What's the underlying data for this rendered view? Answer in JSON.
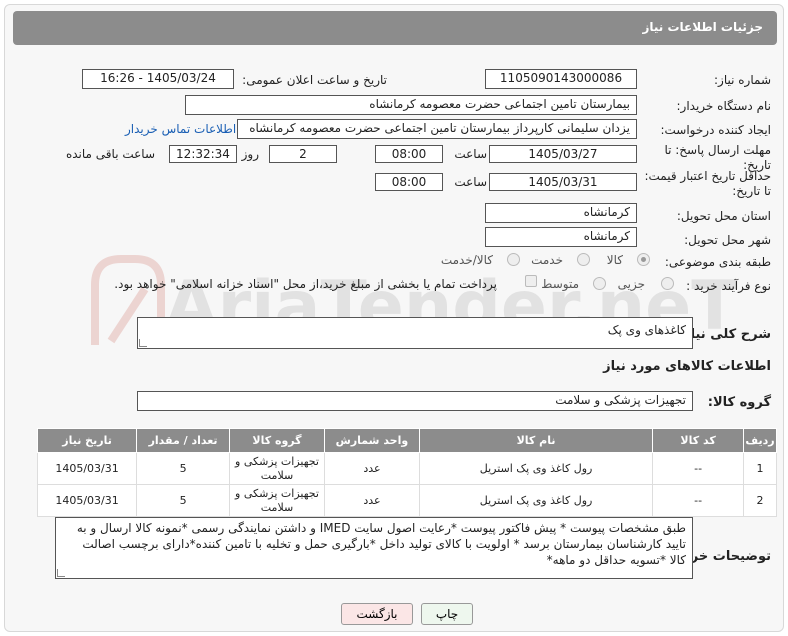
{
  "header": {
    "title": "جزئیات اطلاعات نیاز"
  },
  "form": {
    "need_number_label": "شماره نیاز:",
    "need_number": "1105090143000086",
    "announce_label": "تاریخ و ساعت اعلان عمومی:",
    "announce_value": "1405/03/24 - 16:26",
    "buyer_label": "نام دستگاه خریدار:",
    "buyer_value": "بیمارستان تامین اجتماعی حضرت معصومه کرمانشاه",
    "creator_label": "ایجاد کننده درخواست:",
    "creator_value": "یزدان  سلیمانی کارپرداز بیمارستان تامین اجتماعی حضرت معصومه کرمانشاه",
    "contact_link": "اطلاعات تماس خریدار",
    "deadline_label_1": "مهلت ارسال پاسخ: تا",
    "deadline_label_2": "تاریخ:",
    "deadline_date": "1405/03/27",
    "time_label": "ساعت",
    "deadline_time": "08:00",
    "days_value": "2",
    "days_label": "روز و",
    "remaining_time": "12:32:34",
    "remaining_label": "ساعت باقی مانده",
    "price_label_1": "حداقل تاریخ اعتبار قیمت:",
    "price_label_2": "تا تاریخ:",
    "price_date": "1405/03/31",
    "price_time": "08:00",
    "province_label": "استان محل تحویل:",
    "province_value": "کرمانشاه",
    "city_label": "شهر محل تحویل:",
    "city_value": "کرمانشاه",
    "category_label": "طبقه بندی موضوعی:",
    "category_options": [
      "کالا",
      "خدمت",
      "کالا/خدمت"
    ],
    "process_label": "نوع فرآیند خرید :",
    "process_options": [
      "جزیی",
      "متوسط"
    ],
    "payment_note": "پرداخت تمام یا بخشی از مبلغ خرید،از محل \"اسناد خزانه اسلامی\" خواهد بود.",
    "description_label": "شرح کلی نیاز:",
    "description_value": "کاغذهای وی پک",
    "goods_info_title": "اطلاعات کالاهای مورد نیاز",
    "goods_group_label": "گروه کالا:",
    "goods_group_value": "تجهیزات پزشکی و سلامت"
  },
  "table": {
    "headers": [
      "ردیف",
      "کد کالا",
      "نام کالا",
      "واحد شمارش",
      "گروه کالا",
      "تعداد / مقدار",
      "تاریخ نیاز"
    ],
    "rows": [
      [
        "1",
        "--",
        "رول کاغذ وی پک استریل",
        "عدد",
        "تجهیزات پزشکی و سلامت",
        "5",
        "1405/03/31"
      ],
      [
        "2",
        "--",
        "رول کاغذ وی پک استریل",
        "عدد",
        "تجهیزات پزشکی و سلامت",
        "5",
        "1405/03/31"
      ]
    ]
  },
  "buyer_notes": {
    "label": "توضیحات خریدار:",
    "value": "طبق مشخصات پیوست * پیش فاکتور پیوست *رعایت اصول سایت IMED و داشتن نمایندگی رسمی *نمونه کالا ارسال و به تایید کارشناسان بیمارستان برسد * اولویت با کالای تولید داخل  *بارگیری حمل و تخلیه با تامین کننده*دارای برچسب اصالت کالا *تسویه حداقل دو ماهه*"
  },
  "buttons": {
    "print": "چاپ",
    "back": "بازگشت"
  },
  "watermark": "AriaTender.neT",
  "colors": {
    "header_bg": "#8c8c8c",
    "link": "#1a5fb4",
    "print_bg": "#eef7ee",
    "back_bg": "#fbe6e6"
  }
}
